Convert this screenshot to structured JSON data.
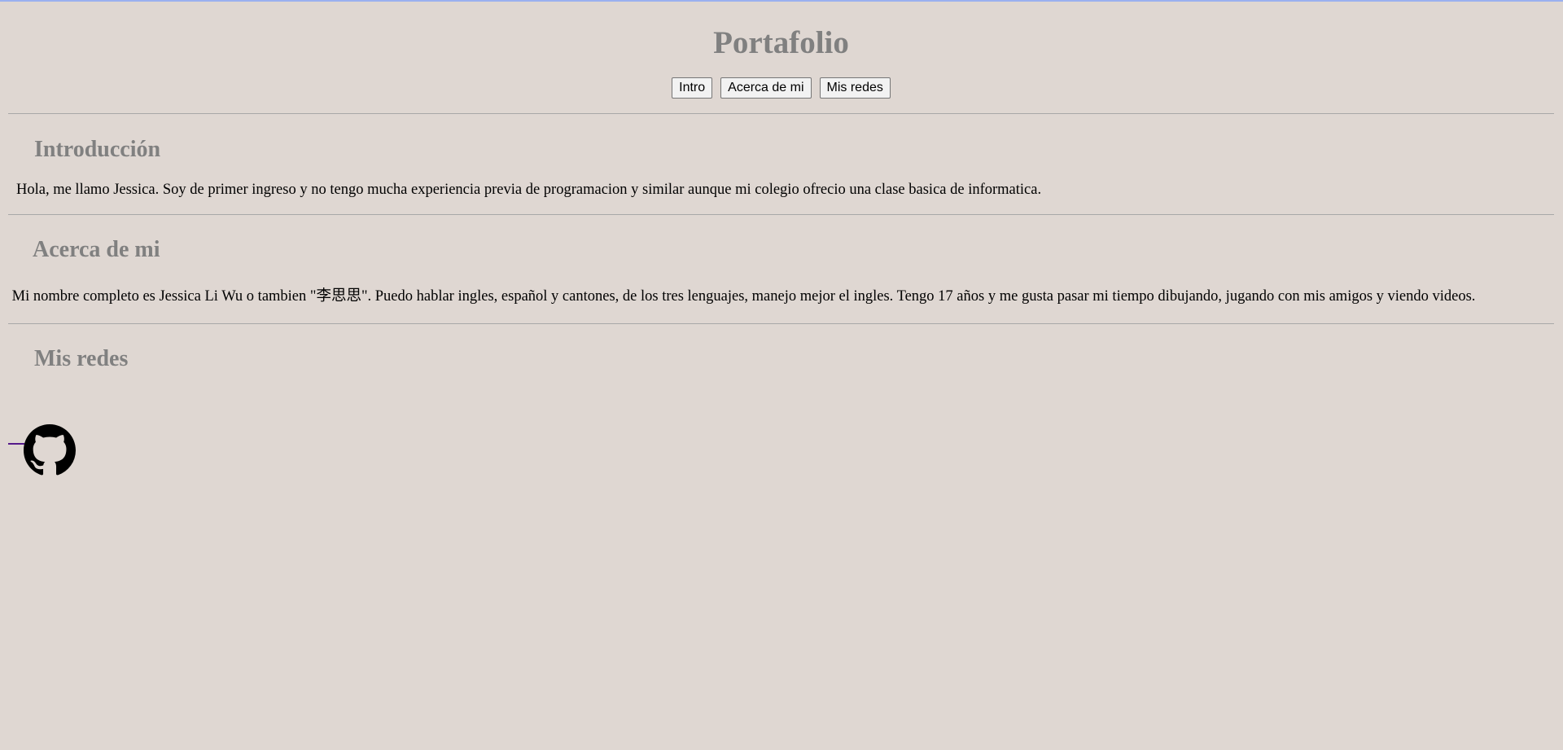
{
  "header": {
    "title": "Portafolio"
  },
  "nav": {
    "items": [
      {
        "label": "Intro"
      },
      {
        "label": "Acerca de mi"
      },
      {
        "label": "Mis redes"
      }
    ]
  },
  "sections": {
    "intro": {
      "heading": "Introducción",
      "text": "Hola, me llamo Jessica. Soy de primer ingreso y no tengo mucha experiencia previa de programacion y similar aunque mi colegio ofrecio una clase basica de informatica."
    },
    "about": {
      "heading": "Acerca de mi",
      "text": " Mi nombre completo es Jessica Li Wu o tambien \"李思思\". Puedo hablar ingles, español y cantones, de los tres lenguajes, manejo mejor el ingles. Tengo 17 años y me gusta pasar mi tiempo dibujando, jugando con mis amigos y viendo videos."
    },
    "social": {
      "heading": "Mis redes",
      "links": [
        {
          "icon": "github-icon"
        }
      ]
    }
  },
  "colors": {
    "background": "#dfd7d2",
    "heading": "#808080",
    "top_strip": "#9ab0f0",
    "link": "#551a8b"
  }
}
